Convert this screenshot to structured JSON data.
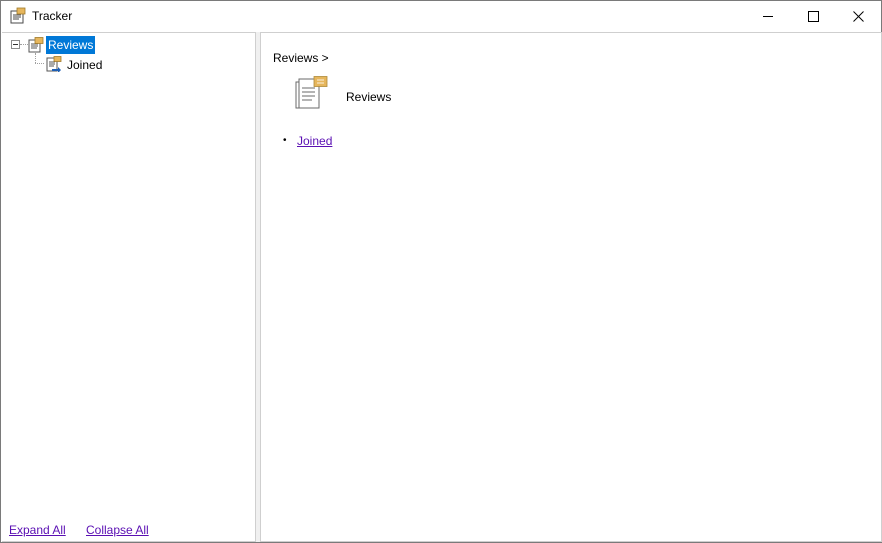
{
  "window": {
    "title": "Tracker",
    "controls": {
      "minimize": "minimize",
      "maximize": "maximize",
      "close": "close"
    }
  },
  "tree": {
    "nodes": [
      {
        "label": "Reviews",
        "selected": true,
        "expanded": true,
        "icon": "reviews-folder-icon"
      },
      {
        "label": "Joined",
        "selected": false,
        "icon": "document-arrow-icon"
      }
    ]
  },
  "left_footer": {
    "expand_all": "Expand All",
    "collapse_all": "Collapse All"
  },
  "content": {
    "breadcrumb": "Reviews >",
    "heading": "Reviews",
    "heading_icon": "document-stack-icon",
    "children": [
      "Joined"
    ]
  },
  "colors": {
    "selection": "#0078d7",
    "link": "#5a0fb3",
    "accent_note": "#e6b65c"
  }
}
